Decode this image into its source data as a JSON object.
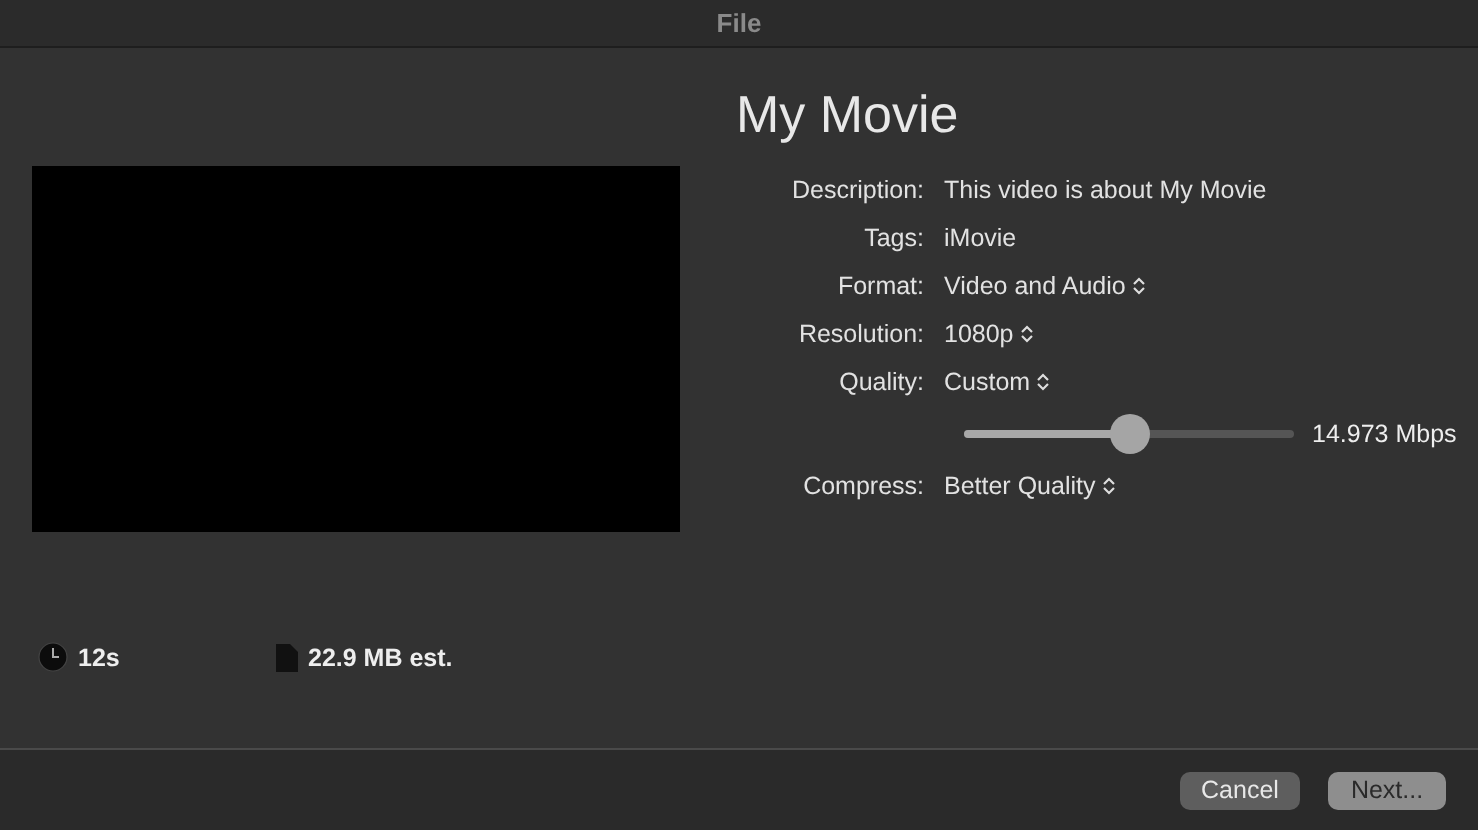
{
  "window": {
    "title": "File"
  },
  "preview": {
    "kind": "video"
  },
  "movie_title": "My Movie",
  "fields": [
    {
      "label": "Description:",
      "value": "This video is about My Movie",
      "kind": "text"
    },
    {
      "label": "Tags:",
      "value": "iMovie",
      "kind": "text"
    },
    {
      "label": "Format:",
      "value": "Video and Audio",
      "kind": "popup"
    },
    {
      "label": "Resolution:",
      "value": "1080p",
      "kind": "popup"
    },
    {
      "label": "Quality:",
      "value": "Custom",
      "kind": "popup"
    },
    {
      "kind": "slider",
      "level": 0.5,
      "reading": "14.973 Mbps"
    },
    {
      "label": "Compress:",
      "value": "Better Quality",
      "kind": "popup"
    }
  ],
  "duration": "12s",
  "size": "22.9 MB est.",
  "buttons": [
    {
      "label": "Cancel",
      "kind": "secondary"
    },
    {
      "label": "Next...",
      "kind": "primary"
    }
  ]
}
